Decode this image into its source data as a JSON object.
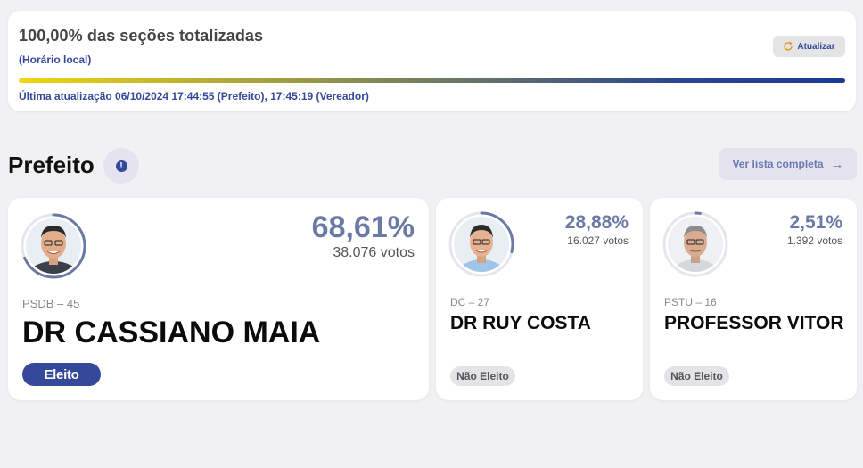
{
  "status": {
    "title": "100,00% das seções totalizadas",
    "subtitle": "(Horário local)",
    "refresh_label": "Atualizar",
    "progress_percent": 100,
    "last_update": "Última atualização 06/10/2024 17:44:55 (Prefeito), 17:45:19 (Vereador)"
  },
  "section": {
    "title": "Prefeito",
    "info_icon": "exclamation-icon",
    "info_symbol": "!",
    "full_list_label": "Ver lista completa",
    "full_list_arrow": "→"
  },
  "candidates": [
    {
      "name": "DR CASSIANO MAIA",
      "party": "PSDB – 45",
      "percent": "68,61%",
      "percent_value": 68.61,
      "votes": "38.076 votos",
      "status": "Eleito",
      "elected": true
    },
    {
      "name": "DR RUY COSTA",
      "party": "DC – 27",
      "percent": "28,88%",
      "percent_value": 28.88,
      "votes": "16.027 votos",
      "status": "Não Eleito",
      "elected": false
    },
    {
      "name": "PROFESSOR VITOR",
      "party": "PSTU – 16",
      "percent": "2,51%",
      "percent_value": 2.51,
      "votes": "1.392 votos",
      "status": "Não Eleito",
      "elected": false
    }
  ],
  "colors": {
    "brand": "#34499a",
    "percent": "#6b7aa4",
    "ring_track": "#e6e6ea",
    "progress_start": "#f2d60f",
    "progress_end": "#1d3a94"
  }
}
